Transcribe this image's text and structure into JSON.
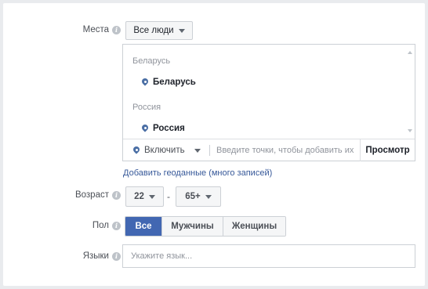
{
  "places": {
    "label": "Места",
    "audience_select": "Все люди",
    "groups": [
      {
        "title": "Беларусь",
        "item": "Беларусь"
      },
      {
        "title": "Россия",
        "item": "Россия"
      }
    ],
    "include_label": "Включить",
    "input_placeholder": "Введите точки, чтобы добавить их",
    "browse_label": "Просмотр",
    "bulk_link": "Добавить геоданные (много записей)"
  },
  "age": {
    "label": "Возраст",
    "min": "22",
    "separator": "-",
    "max": "65+"
  },
  "gender": {
    "label": "Пол",
    "options": [
      "Все",
      "Мужчины",
      "Женщины"
    ],
    "selected": "Все"
  },
  "languages": {
    "label": "Языки",
    "placeholder": "Укажите язык..."
  },
  "colors": {
    "accent": "#4267b2",
    "link": "#365899",
    "pin": "#4b6fa5"
  }
}
